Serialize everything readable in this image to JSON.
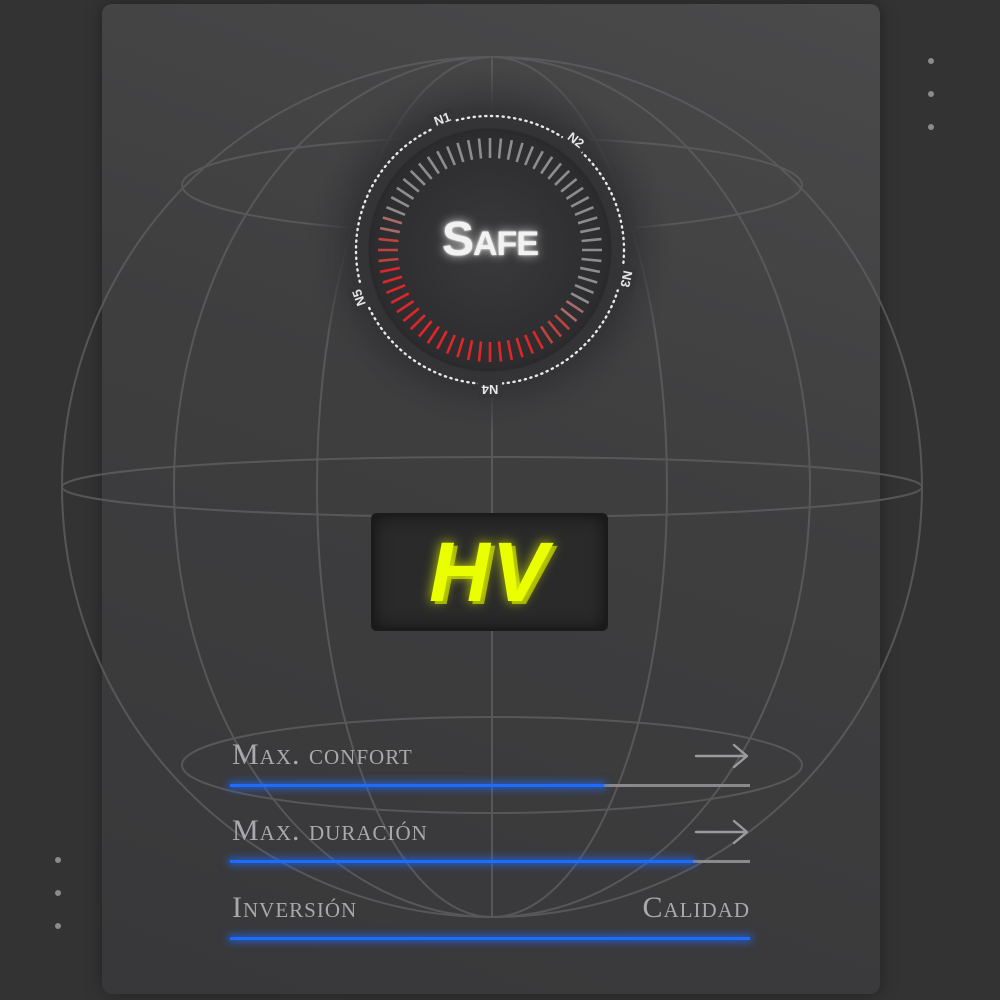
{
  "dial": {
    "label": "Safe",
    "markers": [
      "N1",
      "N2",
      "N3",
      "N4",
      "N5"
    ]
  },
  "badge": {
    "label": "HV"
  },
  "options": [
    {
      "label": "Max. confort",
      "icon": "arrow-right-icon",
      "progress": 0.72
    },
    {
      "label": "Max. duración",
      "icon": "arrow-right-icon",
      "progress": 0.89
    },
    {
      "label": "Inversión",
      "right_label": "Calidad",
      "progress": 1.0
    }
  ],
  "colors": {
    "accent_blue": "#1e6bff",
    "badge_yellow": "#eaff00",
    "dial_red": "#e0262a",
    "background": "#333334"
  }
}
